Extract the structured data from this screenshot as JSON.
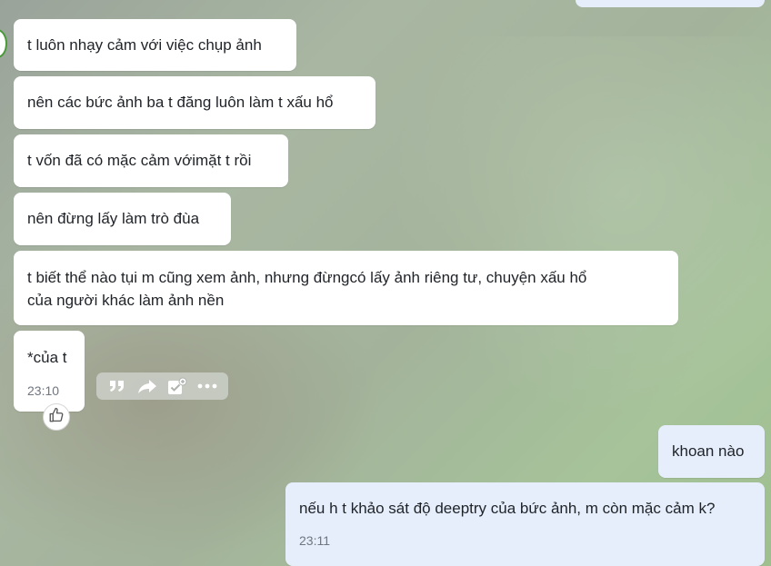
{
  "messages": [
    {
      "text": "t luôn nhạy cảm với việc chụp ảnh"
    },
    {
      "text": "nên các bức ảnh ba t đăng luôn làm t xấu hổ"
    },
    {
      "text": "t vốn đã có mặc cảm vớimặt t rồi"
    },
    {
      "text": "nên đừng lấy làm trò đùa"
    },
    {
      "text": "t biết thể nào tụi m cũng xem ảnh, nhưng đừngcó lấy ảnh riêng tư, chuyện xấu hổ",
      "text2": "của người khác làm ảnh nền"
    },
    {
      "text": "*của t",
      "time": "23:10"
    },
    {
      "text": "khoan nào"
    },
    {
      "text": "nếu h t khảo sát độ deeptry của bức ảnh, m còn mặc cảm k?",
      "time": "23:11"
    }
  ],
  "toolbar": {
    "icons": [
      "quote-icon",
      "forward-icon",
      "add-task-icon",
      "more-icon"
    ]
  },
  "reaction": {
    "icon": "thumbs-up-icon"
  },
  "colors": {
    "incoming_bubble": "#ffffff",
    "outgoing_bubble": "#e6eefc",
    "text": "#1f2328",
    "time": "#6f7680"
  }
}
